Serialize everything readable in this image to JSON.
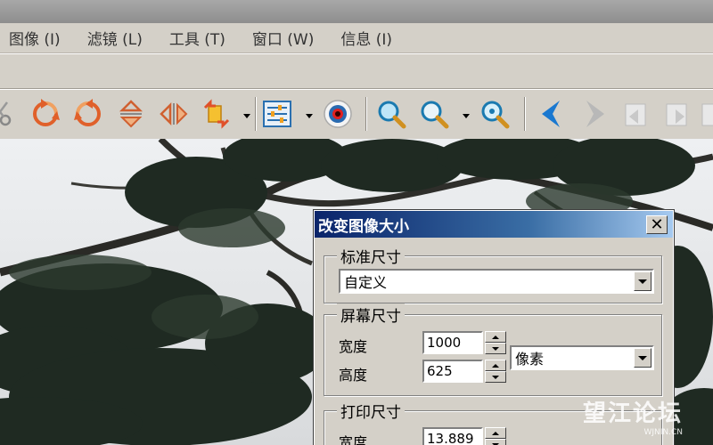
{
  "menu": {
    "items": [
      {
        "label": "图像 (I)"
      },
      {
        "label": "滤镜 (L)"
      },
      {
        "label": "工具 (T)"
      },
      {
        "label": "窗口 (W)"
      },
      {
        "label": "信息 (I)"
      }
    ]
  },
  "toolbar": {
    "icons": [
      "scissors-icon",
      "rotate-left-icon",
      "rotate-right-icon",
      "flip-vertical-icon",
      "flip-horizontal-icon",
      "transform-icon",
      "adjust-panel-icon",
      "red-eye-icon",
      "zoom-in-icon",
      "zoom-out-icon",
      "zoom-fit-icon",
      "prev-arrow-icon",
      "next-arrow-icon",
      "back-icon",
      "forward-icon"
    ]
  },
  "dialog": {
    "title": "改变图像大小",
    "standard": {
      "legend": "标准尺寸",
      "selected": "自定义"
    },
    "screen": {
      "legend": "屏幕尺寸",
      "width_label": "宽度",
      "width_value": "1000",
      "height_label": "高度",
      "height_value": "625",
      "unit_selected": "像素"
    },
    "print": {
      "legend": "打印尺寸",
      "width_label": "宽度",
      "width_value": "13.889"
    }
  },
  "watermark": {
    "main": "望江论坛",
    "sub": "WJNIN.CN"
  },
  "colors": {
    "title_bar_start": "#0a246a",
    "title_bar_end": "#a6caf0",
    "chrome": "#d4d0c8"
  }
}
